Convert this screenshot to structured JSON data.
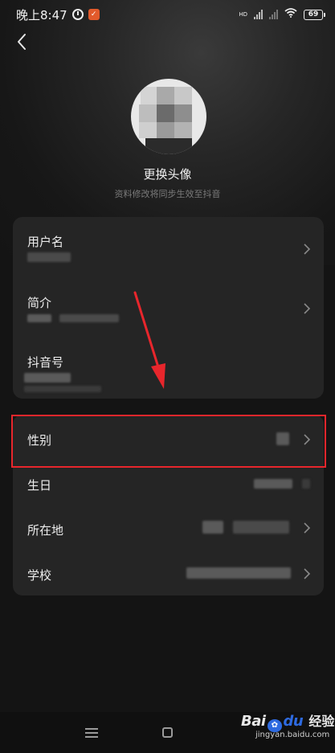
{
  "statusbar": {
    "time": "晚上8:47",
    "network": "HD",
    "battery": "69"
  },
  "profile": {
    "change_avatar_label": "更换头像",
    "sync_note": "资料修改将同步生效至抖音"
  },
  "card1": {
    "rows": [
      {
        "label": "用户名"
      },
      {
        "label": "简介"
      },
      {
        "label": "抖音号"
      }
    ]
  },
  "card2": {
    "rows": [
      {
        "label": "性别"
      },
      {
        "label": "生日"
      },
      {
        "label": "所在地"
      },
      {
        "label": "学校"
      }
    ]
  },
  "watermark": {
    "brand_bai": "Bai",
    "brand_du": "du",
    "brand_cn": "经验",
    "url": "jingyan.baidu.com"
  },
  "colors": {
    "background": "#141414",
    "card": "#252525",
    "highlight": "#e8262c",
    "text": "#ededed",
    "subtext": "#7b7b7b"
  }
}
